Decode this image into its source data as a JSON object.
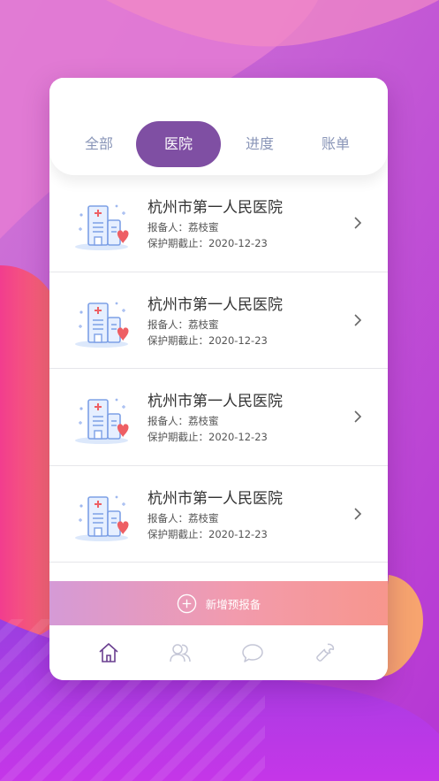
{
  "tabs": {
    "all": "全部",
    "hospital": "医院",
    "progress": "进度",
    "bill": "账单",
    "active": "hospital"
  },
  "list": {
    "items": [
      {
        "title": "杭州市第一人民医院",
        "reporter": "报备人：荔枝蜜",
        "expiry": "保护期截止：2020-12-23"
      },
      {
        "title": "杭州市第一人民医院",
        "reporter": "报备人：荔枝蜜",
        "expiry": "保护期截止：2020-12-23"
      },
      {
        "title": "杭州市第一人民医院",
        "reporter": "报备人：荔枝蜜",
        "expiry": "保护期截止：2020-12-23"
      },
      {
        "title": "杭州市第一人民医院",
        "reporter": "报备人：荔枝蜜",
        "expiry": "保护期截止：2020-12-23"
      }
    ]
  },
  "add_button": {
    "label": "新增预报备",
    "icon": "plus-circle-icon"
  },
  "bottom_nav": [
    {
      "icon": "home-icon",
      "active": true
    },
    {
      "icon": "users-icon",
      "active": false
    },
    {
      "icon": "chat-icon",
      "active": false
    },
    {
      "icon": "wrench-icon",
      "active": false
    }
  ],
  "colors": {
    "accent": "#7f4fa3",
    "tab_inactive": "#8a96b8",
    "nav_active": "#6a3f90",
    "nav_inactive": "#c4c6d6",
    "heart": "#ee5f64",
    "hospital_icon": "#7da0e6"
  }
}
